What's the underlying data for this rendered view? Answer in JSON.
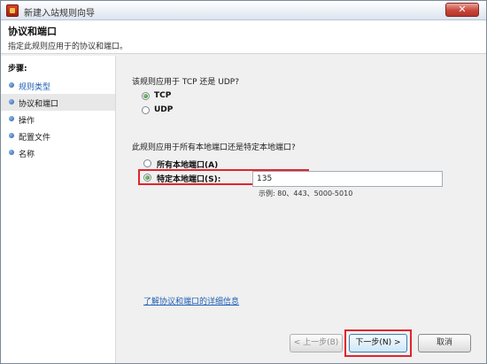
{
  "window": {
    "title": "新建入站规则向导",
    "close_label": "✕"
  },
  "header": {
    "title": "协议和端口",
    "subtitle": "指定此规则应用于的协议和端口。"
  },
  "steps": {
    "heading": "步骤:",
    "items": [
      {
        "label": "规则类型",
        "state": "link"
      },
      {
        "label": "协议和端口",
        "state": "current"
      },
      {
        "label": "操作",
        "state": "normal"
      },
      {
        "label": "配置文件",
        "state": "normal"
      },
      {
        "label": "名称",
        "state": "normal"
      }
    ]
  },
  "protocol": {
    "question": "该规则应用于 TCP 还是 UDP?",
    "options": [
      {
        "label": "TCP",
        "selected": true
      },
      {
        "label": "UDP",
        "selected": false
      }
    ]
  },
  "ports": {
    "question": "此规则应用于所有本地端口还是特定本地端口?",
    "options": [
      {
        "label": "所有本地端口(A)",
        "selected": false
      },
      {
        "label": "特定本地端口(S):",
        "selected": true
      }
    ],
    "value": "135",
    "example": "示例: 80、443、5000-5010"
  },
  "details_link": "了解协议和端口的详细信息",
  "buttons": {
    "back": "< 上一步(B)",
    "next": "下一步(N) >",
    "cancel": "取消"
  },
  "colors": {
    "highlight": "#e0252d",
    "link": "#1f5fb4"
  }
}
